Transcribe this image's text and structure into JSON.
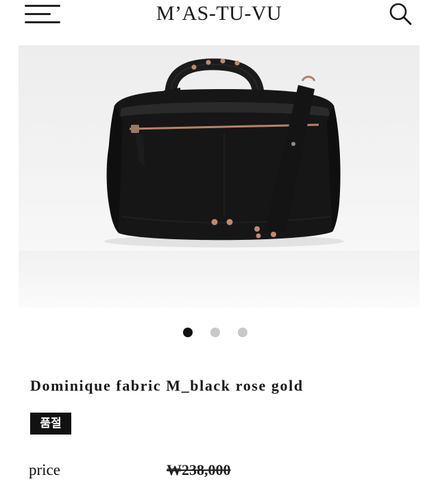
{
  "header": {
    "logo": "M’AS-TU-VU",
    "menu_icon": "hamburger-menu-icon",
    "search_icon": "search-icon"
  },
  "gallery": {
    "image_alt": "black fabric bag with rose gold studs and zipper",
    "slide_count": 3,
    "active_slide": 1
  },
  "product": {
    "name": "Dominique fabric M_black rose gold",
    "badge": "품절",
    "price_label": "price",
    "price": "₩238,000"
  },
  "colors": {
    "text": "#111111",
    "badge_bg": "#111111",
    "badge_text": "#ffffff",
    "dot_active": "#111111",
    "dot_inactive": "#c8c8c8",
    "accent_rose_gold": "#c08a6e"
  }
}
